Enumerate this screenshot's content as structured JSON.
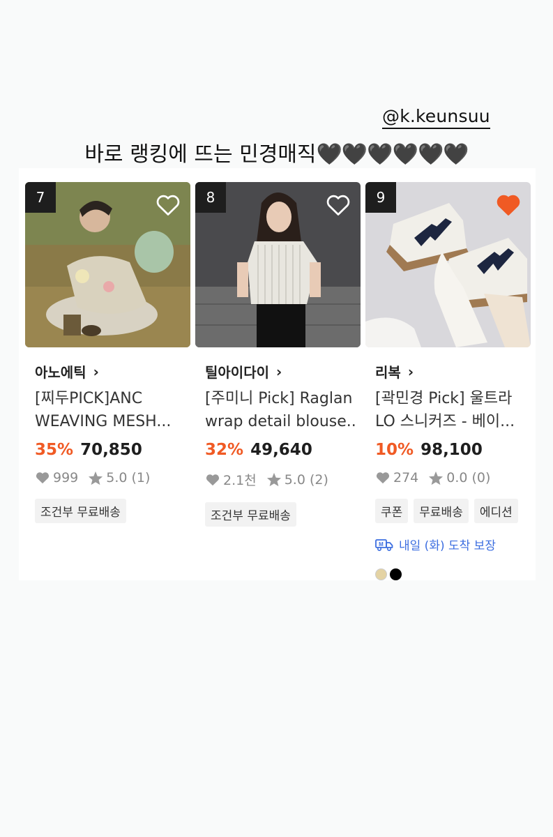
{
  "story": {
    "mention": "@k.keunsuu",
    "caption_text": "바로 랭킹에 뜨는 민경매직",
    "caption_hearts": "🖤🖤🖤🖤🖤🖤"
  },
  "products": [
    {
      "rank": "7",
      "liked": false,
      "brand": "아노에틱",
      "title_line1": "[찌두PICK]ANC",
      "title_line2": "WEAVING MESH...",
      "discount": "35%",
      "price": "70,850",
      "likes": "999",
      "rating": "5.0 (1)",
      "tags": [
        "조건부 무료배송"
      ],
      "image": "woman-sitting-on-grass-photo"
    },
    {
      "rank": "8",
      "liked": false,
      "brand": "틸아이다이",
      "title_line1": "[주미니 Pick] Raglan",
      "title_line2": "wrap detail blouse...",
      "discount": "32%",
      "price": "49,640",
      "likes": "2.1천",
      "rating": "5.0 (2)",
      "tags": [
        "조건부 무료배송"
      ],
      "image": "woman-in-striped-blouse-photo"
    },
    {
      "rank": "9",
      "liked": true,
      "brand": "리복",
      "title_line1": "[곽민경 Pick] 울트라",
      "title_line2": "LO 스니커즈 - 베이...",
      "discount": "10%",
      "price": "98,100",
      "likes": "274",
      "rating": "0.0 (0)",
      "tags": [
        "쿠폰",
        "무료배송",
        "에디션"
      ],
      "delivery": "내일 (화) 도착 보장",
      "swatches": [
        "#e4d3a4",
        "#000000"
      ],
      "image": "white-sneakers-photo"
    }
  ],
  "colors": {
    "discount": "#f05a24",
    "liked_heart": "#f05a24",
    "delivery": "#3c6ee0"
  }
}
